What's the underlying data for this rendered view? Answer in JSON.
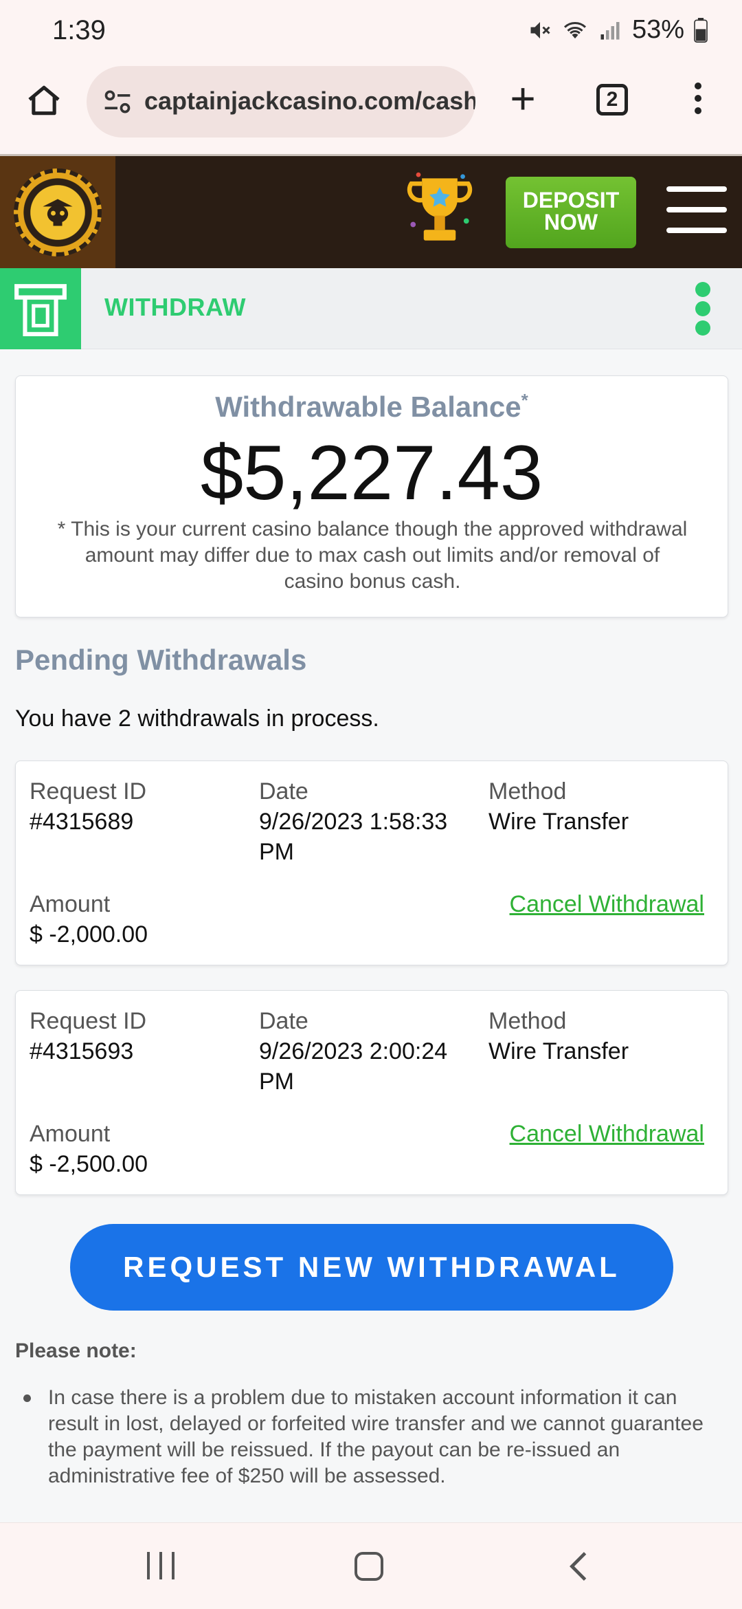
{
  "status_bar": {
    "time": "1:39",
    "battery": "53%",
    "icons": [
      "mute-icon",
      "wifi-icon",
      "signal-icon",
      "battery-icon"
    ]
  },
  "browser": {
    "url": "captainjackcasino.com/cashie",
    "tab_count": "2",
    "icons": [
      "home-icon",
      "site-settings-icon",
      "plus-icon",
      "tabs-icon",
      "menu-icon"
    ]
  },
  "header": {
    "deposit_label_line1": "DEPOSIT",
    "deposit_label_line2": "NOW",
    "icons": [
      "casino-logo-icon",
      "trophy-icon",
      "hamburger-menu-icon"
    ]
  },
  "withdraw_bar": {
    "title": "WITHDRAW",
    "icons": [
      "atm-icon",
      "kebab-menu-icon"
    ]
  },
  "balance": {
    "label": "Withdrawable Balance",
    "label_mark": "*",
    "amount": "$5,227.43",
    "note": "* This is your current casino balance though the approved withdrawal amount may differ due to max cash out limits and/or removal of casino bonus cash."
  },
  "pending": {
    "title": "Pending Withdrawals",
    "count_text": "You have 2 withdrawals in process.",
    "labels": {
      "request_id": "Request ID",
      "date": "Date",
      "method": "Method",
      "amount": "Amount",
      "cancel": "Cancel Withdrawal"
    },
    "items": [
      {
        "request_id": "#4315689",
        "date": "9/26/2023 1:58:33 PM",
        "method": "Wire Transfer",
        "amount": "$ -2,000.00"
      },
      {
        "request_id": "#4315693",
        "date": "9/26/2023 2:00:24 PM",
        "method": "Wire Transfer",
        "amount": "$ -2,500.00"
      }
    ]
  },
  "request_button": "REQUEST NEW WITHDRAWAL",
  "notes": {
    "title": "Please note:",
    "items": [
      "In case there is a problem due to mistaken account information it can result in lost, delayed or forfeited wire transfer and we cannot guarantee the payment will be reissued. If the payout can be re-issued an administrative fee of $250 will be assessed."
    ]
  },
  "colors": {
    "accent_green": "#2ecc71",
    "deposit_green": "#5cb025",
    "link_green": "#2eb135",
    "primary_blue": "#1a73e8",
    "header_brown": "#2a1d14",
    "heading_gray": "#8090a4"
  }
}
